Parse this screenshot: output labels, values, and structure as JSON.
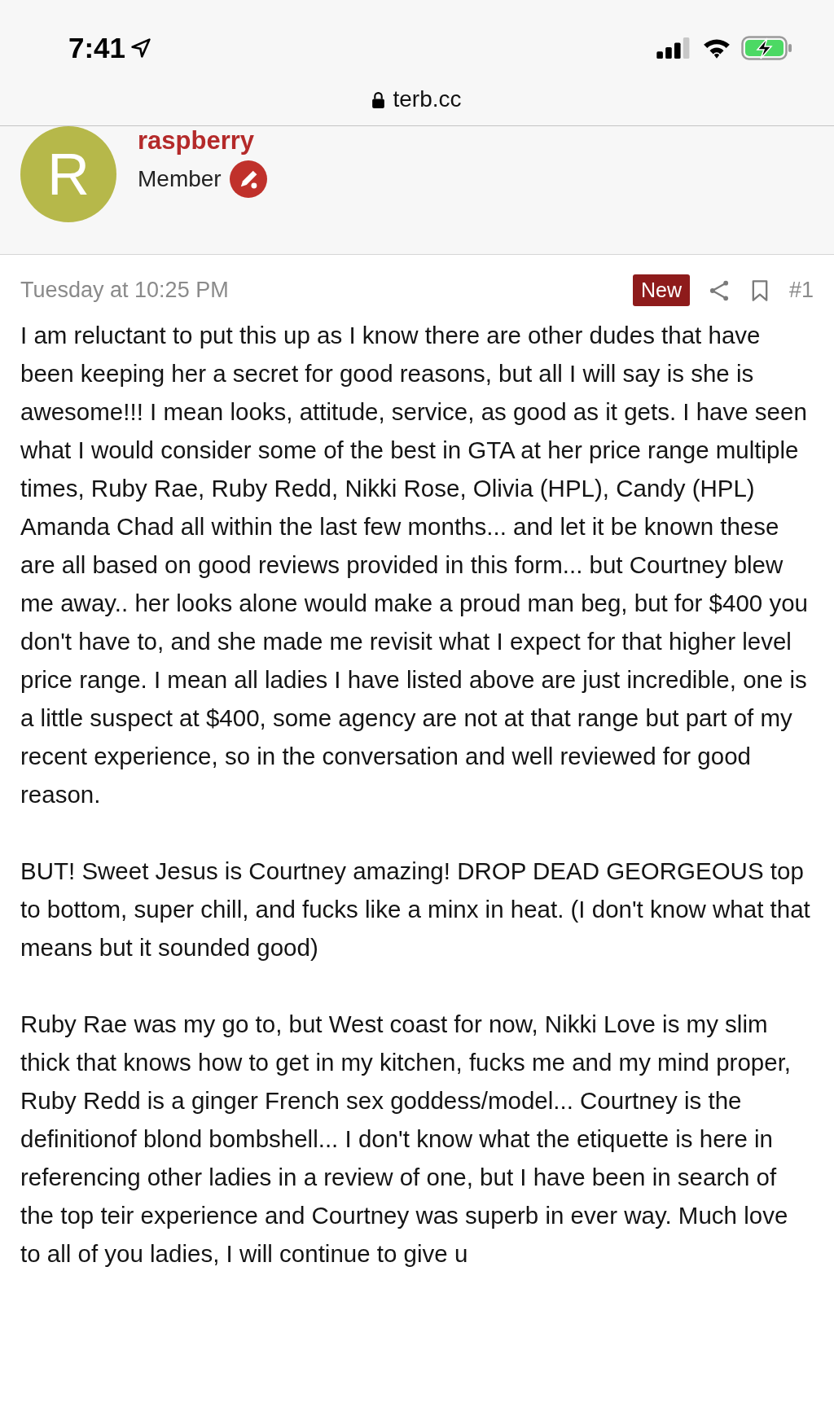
{
  "status_bar": {
    "time": "7:41"
  },
  "address_bar": {
    "url": "terb.cc"
  },
  "author": {
    "avatar_letter": "R",
    "name": "raspberry",
    "role": "Member"
  },
  "post": {
    "date": "Tuesday at 10:25 PM",
    "badge": "New",
    "number": "#1",
    "paragraphs": [
      "I am reluctant to put this up as I know there are other dudes that have been keeping her a secret for good reasons, but all I will say is she is awesome!!! I mean looks, attitude, service, as good as it gets. I have seen what I would consider some of the best in GTA at her price range multiple times, Ruby Rae, Ruby Redd, Nikki Rose, Olivia (HPL), Candy (HPL) Amanda Chad all within the last few months... and let it be known these are all based on good reviews provided in this form... but Courtney blew me away.. her looks alone would make a proud man beg, but for $400 you don't have to, and she made me revisit what I expect for that higher level price range. I mean all ladies I have listed above are just incredible, one is a little suspect at $400, some agency are not at that range but part of my recent experience, so in the conversation and well reviewed for good reason.",
      "BUT! Sweet Jesus is Courtney amazing! DROP DEAD GEORGEOUS top to bottom, super chill, and fucks like a minx in heat. (I don't know what that means but it sounded good)",
      "Ruby Rae was my go to, but West coast for now, Nikki Love is my slim thick that knows how to get in my kitchen, fucks me and my mind proper, Ruby Redd is a ginger French sex goddess/model... Courtney is the definitionof blond bombshell... I don't know what the etiquette is here in referencing other ladies in a review of one, but I have been in search of the top teir experience and Courtney was superb in ever way. Much love to all of you ladies, I will continue to give u"
    ]
  }
}
